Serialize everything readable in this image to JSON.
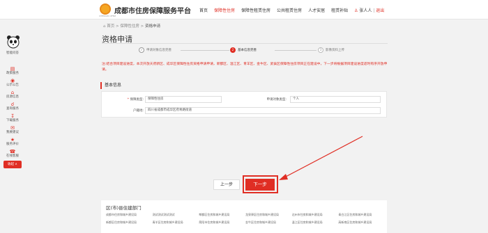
{
  "header": {
    "logo_text": "CHENGDU ZFBZ",
    "site_title": "成都市住房保障服务平台",
    "nav": [
      {
        "label": "首页",
        "active": false
      },
      {
        "label": "保障性住房",
        "active": true
      },
      {
        "label": "保障性租赁住房",
        "active": false
      },
      {
        "label": "公共租赁住房",
        "active": false
      },
      {
        "label": "人才安居",
        "active": false
      },
      {
        "label": "租赁补贴",
        "active": false
      }
    ],
    "user_name": "张人人",
    "separator": "|",
    "logout": "退出"
  },
  "sidebar": {
    "items": [
      {
        "label": "智能问答",
        "icon": "panda-avatar-icon"
      },
      {
        "label": "政策服务",
        "icon": "document-icon"
      },
      {
        "label": "公示公告",
        "icon": "megaphone-icon"
      },
      {
        "label": "房源信息",
        "icon": "house-icon"
      },
      {
        "label": "查询服务",
        "icon": "search-icon"
      },
      {
        "label": "下载服务",
        "icon": "download-icon"
      },
      {
        "label": "我要建议",
        "icon": "mail-icon"
      },
      {
        "label": "服务评价",
        "icon": "rating-icon"
      },
      {
        "label": "在线客服",
        "icon": "headset-icon"
      }
    ],
    "collapse_label": "收起 ∧"
  },
  "breadcrumb": {
    "home": "首页",
    "sep": ">",
    "section": "保障性住房",
    "current": "资格申请"
  },
  "page_title": "资格申请",
  "steps": [
    {
      "num": "1",
      "label": "申请对象信息完善",
      "state": "done"
    },
    {
      "num": "2",
      "label": "基本信息完善",
      "state": "current"
    },
    {
      "num": "3",
      "label": "影像资料上传",
      "state": "todo"
    }
  ],
  "notice": "注:结合项目建设进度，本次开放天府新区、成华区保障性住房资格申请申请，新都区、温江区、青羊区、金牛区、武侯区保障性住房项目正在建设中，下一步将根据项目建设进度适时有序开放申请。",
  "basic_info": {
    "heading": "基本信息",
    "star": "*",
    "fields": {
      "guarantee_type_label": "保障类型:",
      "guarantee_type_value": "保障性住房",
      "applicant_type_label": "申请对象类型:",
      "applicant_type_value": "个人",
      "household_label": "户籍地:",
      "household_value": "四川省成都市成华区府青路街道"
    }
  },
  "buttons": {
    "prev": "上一步",
    "next": "下一步"
  },
  "colors": {
    "accent": "#e02e24"
  },
  "footer": {
    "title": "区(市)县住建部门",
    "links": [
      "成都市住房和城乡建设局",
      "测试测试测试测试",
      "郫都区住房和城乡建设局",
      "龙泉驿区住房和城乡建设局",
      "达州市住房和城乡建设局",
      "青白江区住房和城乡建设局",
      "新都区住房和城乡建设局",
      "青羊区住房和城乡建设局",
      "简阳市住房和城乡建设局",
      "金牛区住房和城乡建设局",
      "温江区住房和城乡建设局",
      "高新南区住房和城乡建设局"
    ]
  }
}
